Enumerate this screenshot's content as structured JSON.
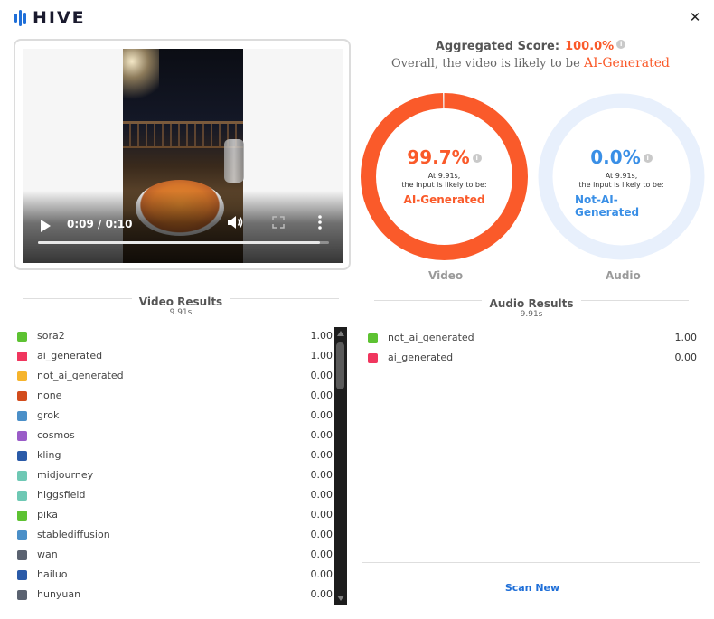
{
  "brand": {
    "name": "HIVE",
    "color": "#1f6fd8"
  },
  "window": {
    "close_icon": "close-icon",
    "close_glyph": "✕"
  },
  "player": {
    "time": "0:09 / 0:10",
    "progress": 0.97,
    "icons": [
      "play-icon",
      "volume-icon",
      "fullscreen-icon",
      "more-vertical-icon"
    ]
  },
  "aggregate": {
    "label": "Aggregated Score:",
    "score": "100.0%",
    "overall_prefix": "Overall, the video is likely to be",
    "overall_verdict": "AI-Generated"
  },
  "video_summary": {
    "percent": "99.7%",
    "percent_value": 99.7,
    "at_line1": "At 9.91s,",
    "at_line2": "the input is likely to be:",
    "verdict": "AI-Generated",
    "label": "Video",
    "ring_color": "#fa5a2a"
  },
  "audio_summary": {
    "percent": "0.0%",
    "percent_value": 0.0,
    "at_line1": "At 9.91s,",
    "at_line2": "the input is likely to be:",
    "verdict_line1": "Not-AI-",
    "verdict_line2": "Generated",
    "label": "Audio",
    "ring_color": "#e8f0fc"
  },
  "video_results": {
    "title": "Video Results",
    "time": "9.91s",
    "rows": [
      {
        "label": "sora2",
        "value": "1.00",
        "color": "#5dc232"
      },
      {
        "label": "ai_generated",
        "value": "1.00",
        "color": "#f0365e"
      },
      {
        "label": "not_ai_generated",
        "value": "0.00",
        "color": "#f6b42c"
      },
      {
        "label": "none",
        "value": "0.00",
        "color": "#d24c1c"
      },
      {
        "label": "grok",
        "value": "0.00",
        "color": "#4a8fc8"
      },
      {
        "label": "cosmos",
        "value": "0.00",
        "color": "#9a5cc8"
      },
      {
        "label": "kling",
        "value": "0.00",
        "color": "#2a5aa8"
      },
      {
        "label": "midjourney",
        "value": "0.00",
        "color": "#6ec8b4"
      },
      {
        "label": "higgsfield",
        "value": "0.00",
        "color": "#6ec8b4"
      },
      {
        "label": "pika",
        "value": "0.00",
        "color": "#5dc232"
      },
      {
        "label": "stablediffusion",
        "value": "0.00",
        "color": "#4a8fc8"
      },
      {
        "label": "wan",
        "value": "0.00",
        "color": "#5a6270"
      },
      {
        "label": "hailuo",
        "value": "0.00",
        "color": "#2a5aa8"
      },
      {
        "label": "hunyuan",
        "value": "0.00",
        "color": "#5a6270"
      }
    ]
  },
  "audio_results": {
    "title": "Audio Results",
    "time": "9.91s",
    "rows": [
      {
        "label": "not_ai_generated",
        "value": "1.00",
        "color": "#5dc232"
      },
      {
        "label": "ai_generated",
        "value": "0.00",
        "color": "#f0365e"
      }
    ]
  },
  "actions": {
    "scan_new": "Scan New"
  }
}
